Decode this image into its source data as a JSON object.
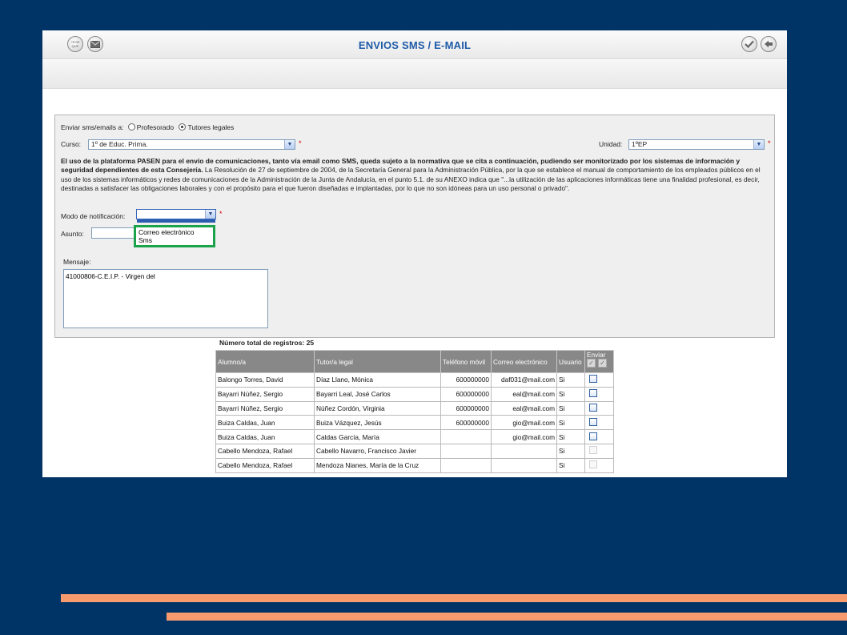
{
  "header": {
    "title": "ENVIOS SMS / E-MAIL",
    "left_icons": [
      "help-icon",
      "mail-icon"
    ],
    "left_icon_labels": {
      "help": "?POR QUE"
    },
    "right_icons": [
      "confirm-check-icon",
      "back-arrow-icon"
    ]
  },
  "form": {
    "send_to_label": "Enviar sms/emails a:",
    "send_to_options": [
      "Profesorado",
      "Tutores legales"
    ],
    "send_to_selected": "Tutores legales",
    "curso_label": "Curso:",
    "curso_value": "1º de Educ. Prima.",
    "unidad_label": "Unidad:",
    "unidad_value": "1ºEP",
    "required_mark": "*",
    "notice_bold": "El uso de la plataforma PASEN para el envío de comunicaciones, tanto vía email como SMS, queda sujeto a la normativa que se cita a continuación, pudiendo ser monitorizado por los sistemas de información y seguridad dependientes de esta Consejería.",
    "notice_text": " La Resolución de 27 de septiembre de 2004, de la Secretaría General para la Administración Pública, por la que se establece el manual de comportamiento de los empleados públicos en el uso de los sistemas informáticos y redes de comunicaciones de la Administración de la Junta de Andalucía, en el punto 5.1. de su ANEXO indica que \"...la utilización de las aplicaciones informáticas tiene una finalidad profesional, es decir, destinadas a satisfacer las obligaciones laborales y con el propósito para el que fueron diseñadas e implantadas, por lo que no son idóneas para un uso personal o privado\".",
    "modo_label": "Modo de notificación:",
    "modo_value": "",
    "modo_options": [
      "Correo electrónico",
      "Sms"
    ],
    "asunto_label": "Asunto:",
    "asunto_value": "",
    "mensaje_label": "Mensaje:",
    "mensaje_value": "41000806-C.E.I.P. - Virgen del"
  },
  "table": {
    "count_label": "Número total de registros: 25",
    "columns": [
      "Alumno/a",
      "Tutor/a legal",
      "Teléfono móvil",
      "Correo electrónico",
      "Usuario",
      "Enviar"
    ],
    "rows": [
      {
        "alumno": "Balongo Torres, David",
        "tutor": "Díaz Llano, Mónica",
        "telefono": "600000000",
        "correo": "daf031@mail.com",
        "usuario": "Si",
        "enviar_enabled": true
      },
      {
        "alumno": "Bayarri Núñez, Sergio",
        "tutor": "Bayarri Leal, José Carlos",
        "telefono": "600000000",
        "correo": "eal@mail.com",
        "usuario": "Si",
        "enviar_enabled": true
      },
      {
        "alumno": "Bayarri Núñez, Sergio",
        "tutor": "Núñez Cordón, Virginia",
        "telefono": "600000000",
        "correo": "eal@mail.com",
        "usuario": "Si",
        "enviar_enabled": true
      },
      {
        "alumno": "Buiza Caldas, Juan",
        "tutor": "Buiza Vázquez, Jesús",
        "telefono": "600000000",
        "correo": "gio@mail.com",
        "usuario": "Si",
        "enviar_enabled": true
      },
      {
        "alumno": "Buiza Caldas, Juan",
        "tutor": "Caldas García, María",
        "telefono": "",
        "correo": "gio@mail.com",
        "usuario": "Si",
        "enviar_enabled": true
      },
      {
        "alumno": "Cabello Mendoza, Rafael",
        "tutor": "Cabello Navarro, Francisco Javier",
        "telefono": "",
        "correo": "",
        "usuario": "Si",
        "enviar_enabled": false
      },
      {
        "alumno": "Cabello Mendoza, Rafael",
        "tutor": "Mendoza Nianes, María de la Cruz",
        "telefono": "",
        "correo": "",
        "usuario": "Si",
        "enviar_enabled": false
      }
    ]
  },
  "colors": {
    "background": "#003366",
    "title": "#1f5ba8",
    "highlight": "#1aa34a",
    "stripe": "#f79b6f",
    "table_header": "#888888"
  }
}
